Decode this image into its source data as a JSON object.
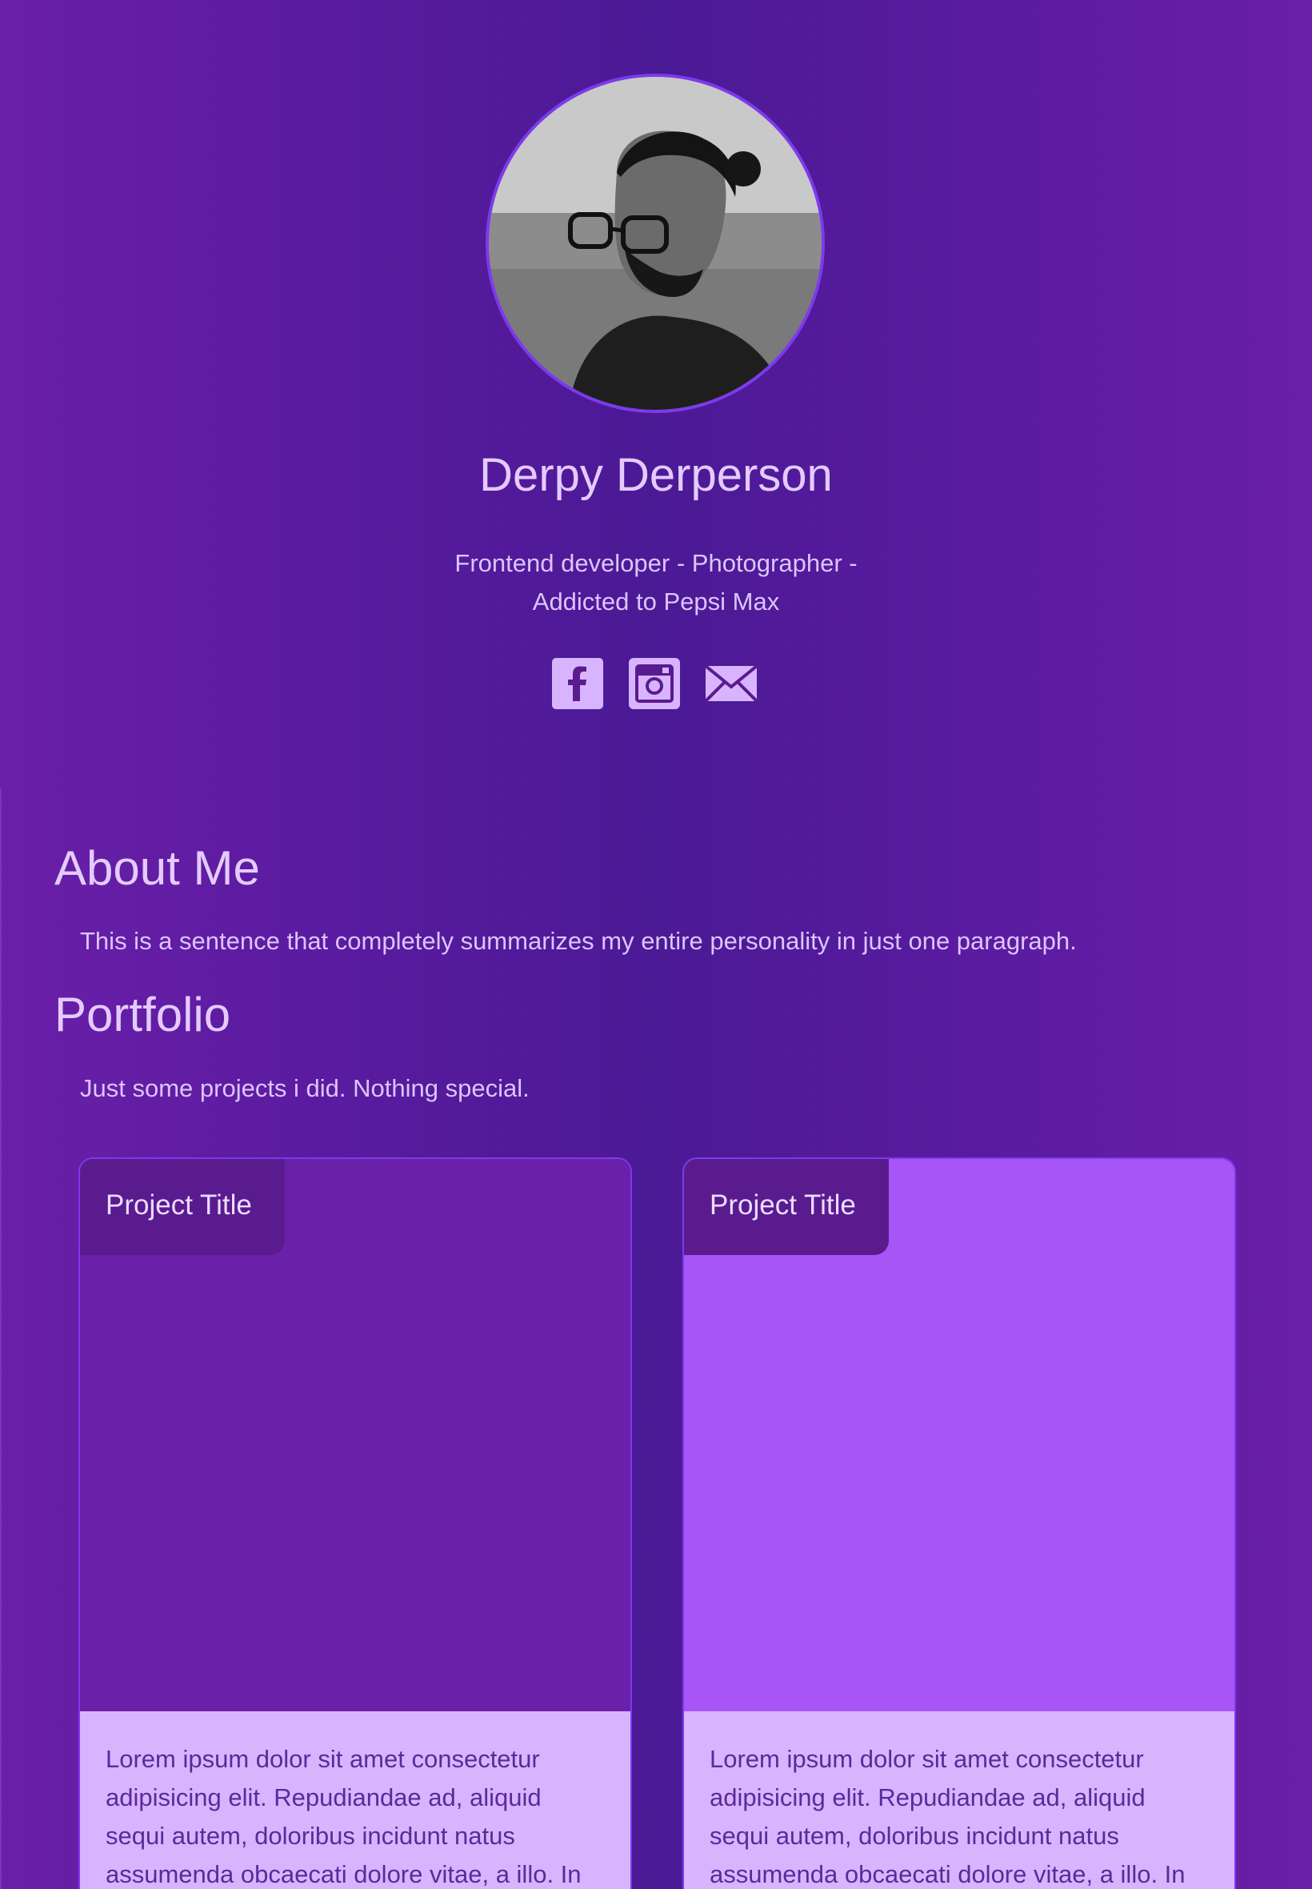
{
  "profile": {
    "avatar_alt": "Profile photo",
    "name": "Derpy Derperson",
    "tagline": "Frontend developer - Photographer - Addicted to Pepsi Max",
    "socials": [
      {
        "icon": "facebook-icon"
      },
      {
        "icon": "instagram-icon"
      },
      {
        "icon": "mail-icon"
      }
    ]
  },
  "about": {
    "title": "About Me",
    "text": "This is a sentence that completely summarizes my entire personality in just one paragraph."
  },
  "portfolio": {
    "title": "Portfolio",
    "text": "Just some projects i did. Nothing special.",
    "projects": [
      {
        "title": "Project Title",
        "description": "Lorem ipsum dolor sit amet consectetur adipisicing elit. Repudiandae ad, aliquid sequi autem, doloribus incidunt natus assumenda obcaecati dolore vitae, a illo. In",
        "image_color": "#6a20a8"
      },
      {
        "title": "Project Title",
        "description": "Lorem ipsum dolor sit amet consectetur adipisicing elit. Repudiandae ad, aliquid sequi autem, doloribus incidunt natus assumenda obcaecati dolore vitae, a illo. In",
        "image_color": "#a855f7"
      }
    ]
  },
  "colors": {
    "accent": "#7c3aed",
    "text": "#e4cbff",
    "card_body": "#d8b4fe",
    "icon": "#d8b4fe"
  }
}
